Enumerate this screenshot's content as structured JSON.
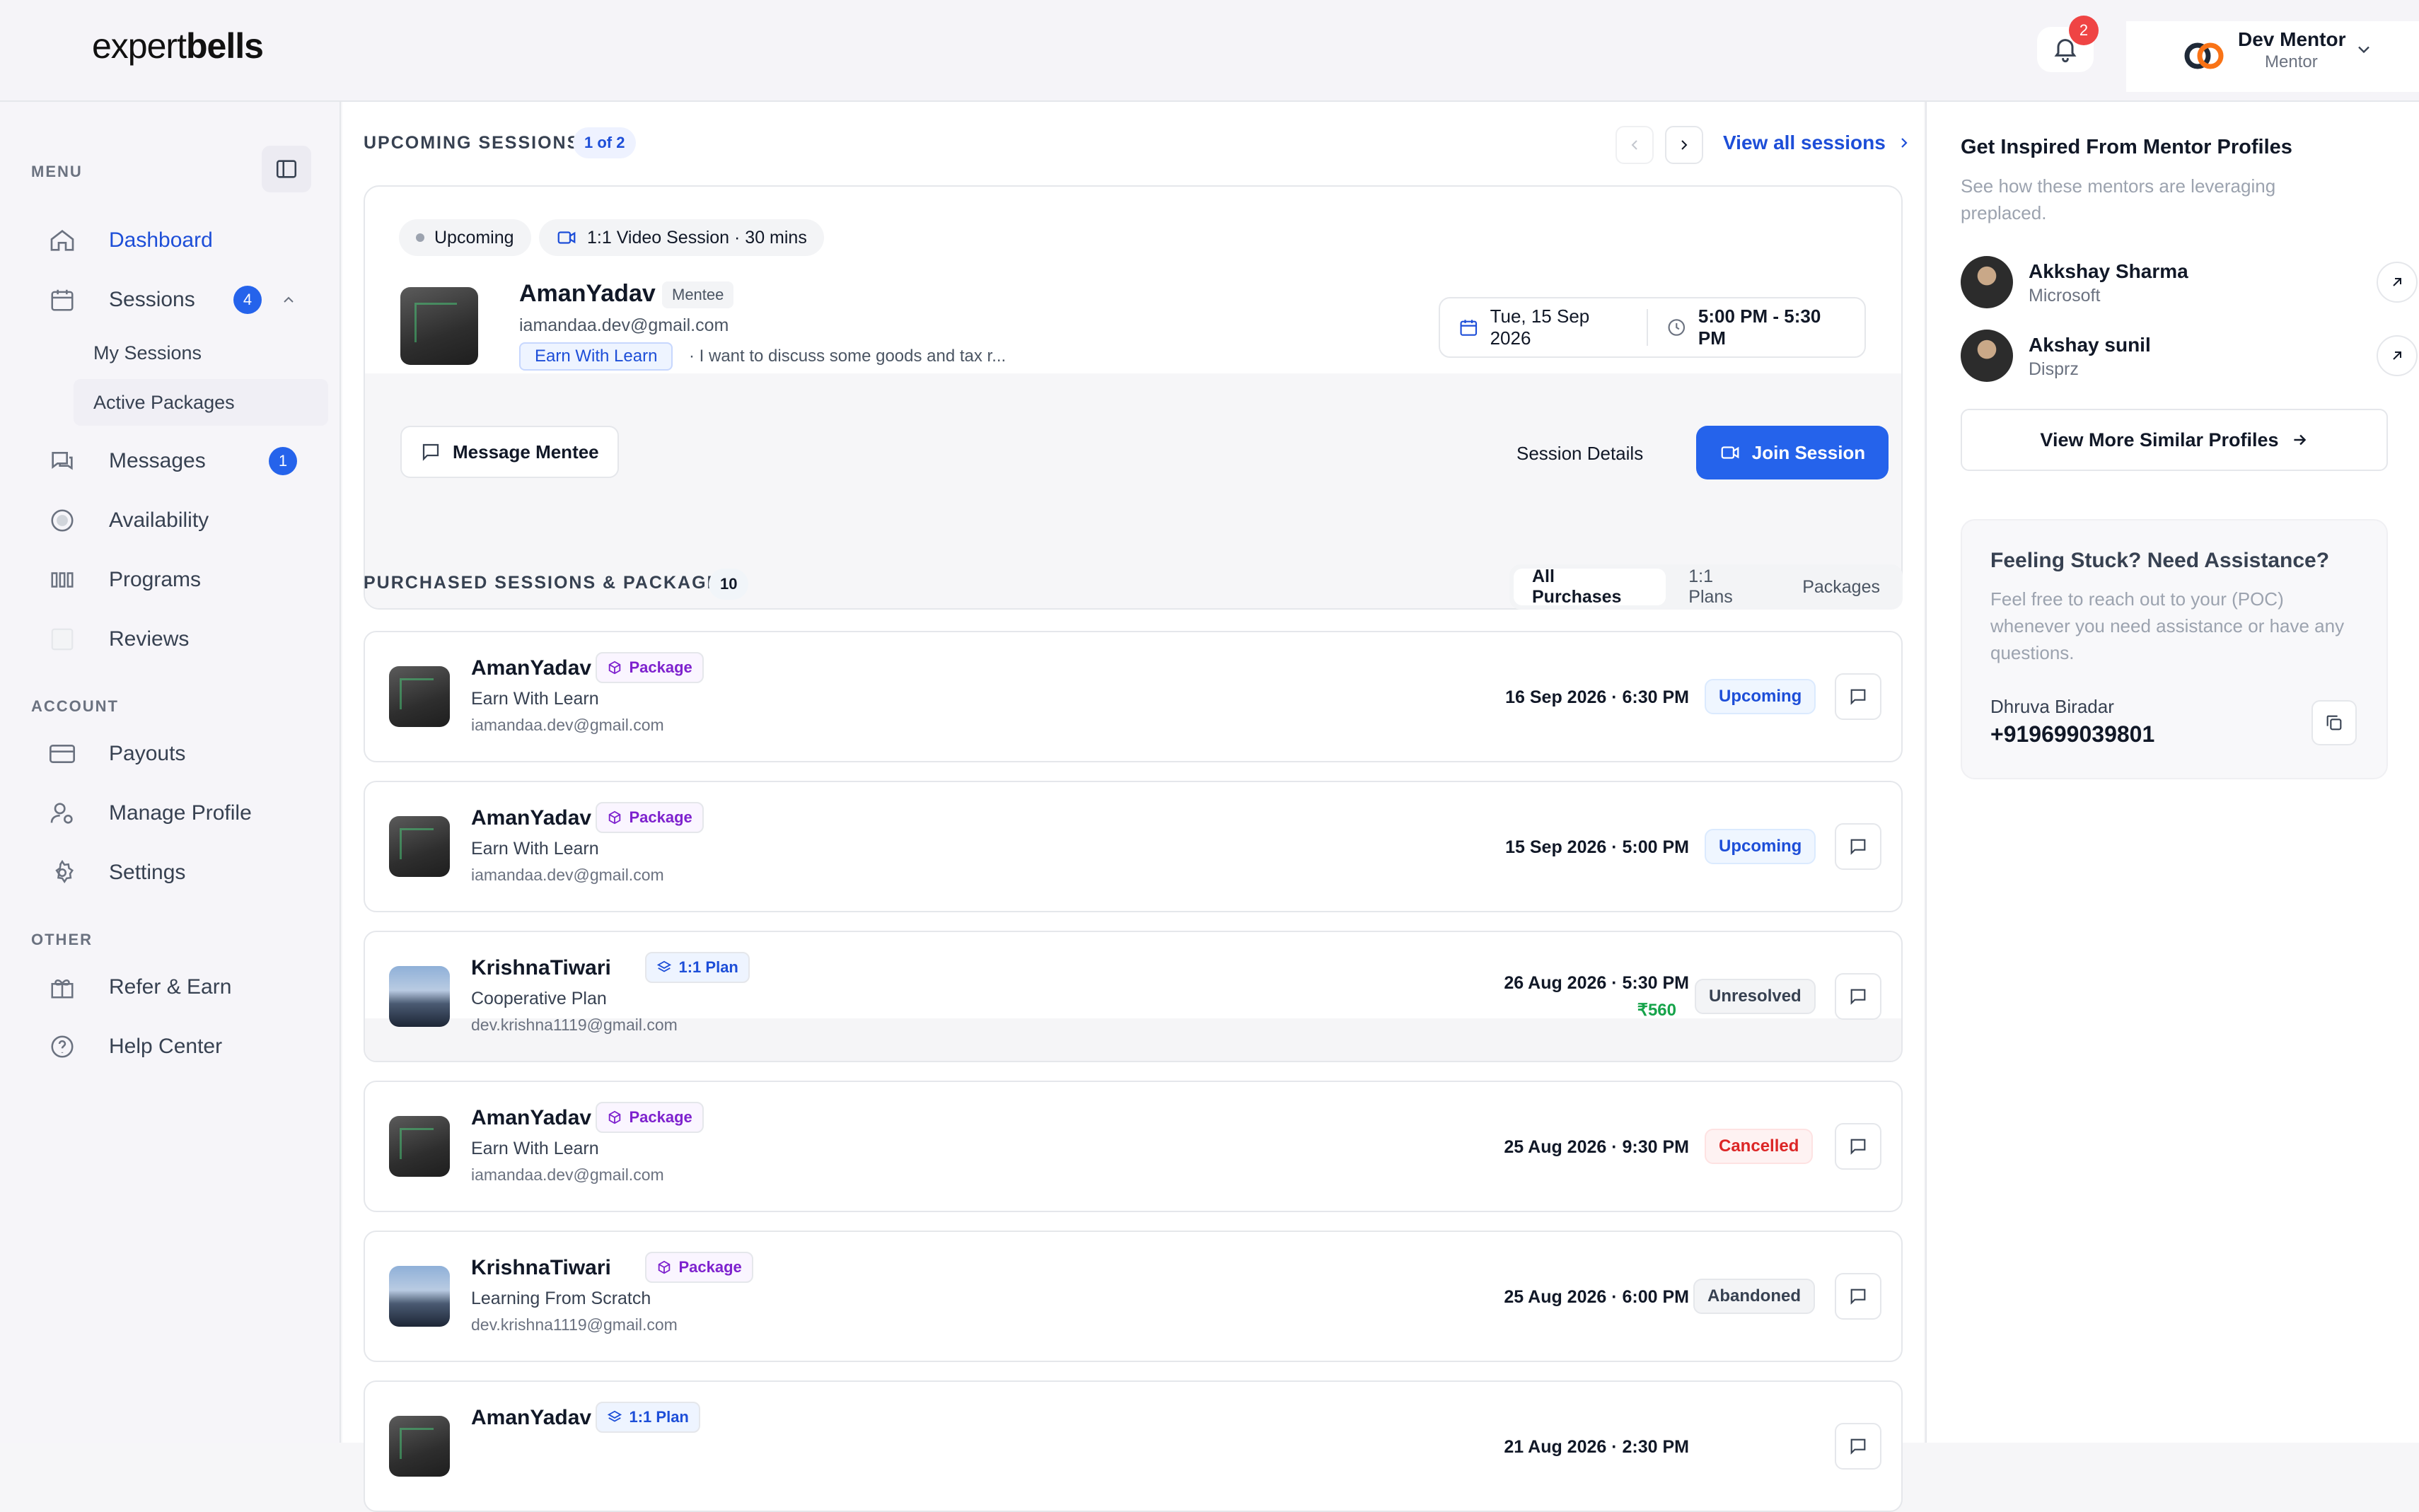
{
  "header": {
    "logo_light": "expert",
    "logo_bold": "bells",
    "notification_count": "2",
    "user_name": "Dev Mentor",
    "user_role": "Mentor"
  },
  "sidebar": {
    "menu_label": "MENU",
    "account_label": "ACCOUNT",
    "other_label": "OTHER",
    "items": {
      "dashboard": "Dashboard",
      "sessions": "Sessions",
      "sessions_badge": "4",
      "my_sessions": "My Sessions",
      "active_packages": "Active Packages",
      "messages": "Messages",
      "messages_badge": "1",
      "availability": "Availability",
      "programs": "Programs",
      "reviews": "Reviews",
      "payouts": "Payouts",
      "manage_profile": "Manage Profile",
      "settings": "Settings",
      "refer_earn": "Refer & Earn",
      "help_center": "Help Center"
    }
  },
  "upcoming": {
    "title": "UPCOMING SESSIONS",
    "pager": "1 of 2",
    "view_all": "View all sessions",
    "card": {
      "status_chip": "Upcoming",
      "type_chip": "1:1 Video Session · 30 mins",
      "name": "AmanYadav",
      "role_tag": "Mentee",
      "email": "iamandaa.dev@gmail.com",
      "topic": "Earn With Learn",
      "note": "· I want to discuss some goods and tax r...",
      "date": "Tue, 15 Sep 2026",
      "time": "5:00 PM - 5:30 PM",
      "message_btn": "Message Mentee",
      "details_btn": "Session Details",
      "join_btn": "Join Session"
    }
  },
  "purchased": {
    "title": "PURCHASED SESSIONS & PACKAGES",
    "count": "10",
    "filters": [
      "All Purchases",
      "1:1 Plans",
      "Packages"
    ],
    "rows": [
      {
        "name": "AmanYadav",
        "type": "Package",
        "kind": "pkg",
        "sub": "Earn With Learn",
        "email": "iamandaa.dev@gmail.com",
        "date": "16 Sep 2026 · 6:30 PM",
        "price": "",
        "status": "Upcoming",
        "status_kind": "up",
        "avatar": "dark"
      },
      {
        "name": "AmanYadav",
        "type": "Package",
        "kind": "pkg",
        "sub": "Earn With Learn",
        "email": "iamandaa.dev@gmail.com",
        "date": "15 Sep 2026 · 5:00 PM",
        "price": "",
        "status": "Upcoming",
        "status_kind": "up",
        "avatar": "dark"
      },
      {
        "name": "KrishnaTiwari",
        "type": "1:1 Plan",
        "kind": "plan",
        "sub": "Cooperative Plan",
        "email": "dev.krishna1119@gmail.com",
        "date": "26 Aug 2026 · 5:30 PM",
        "price": "₹560",
        "status": "Unresolved",
        "status_kind": "unres",
        "avatar": "mount"
      },
      {
        "name": "AmanYadav",
        "type": "Package",
        "kind": "pkg",
        "sub": "Earn With Learn",
        "email": "iamandaa.dev@gmail.com",
        "date": "25 Aug 2026 · 9:30 PM",
        "price": "",
        "status": "Cancelled",
        "status_kind": "canc",
        "avatar": "dark"
      },
      {
        "name": "KrishnaTiwari",
        "type": "Package",
        "kind": "pkg",
        "sub": "Learning From Scratch",
        "email": "dev.krishna1119@gmail.com",
        "date": "25 Aug 2026 · 6:00 PM",
        "price": "",
        "status": "Abandoned",
        "status_kind": "aband",
        "avatar": "mount"
      },
      {
        "name": "AmanYadav",
        "type": "1:1 Plan",
        "kind": "plan",
        "sub": "",
        "email": "",
        "date": "21 Aug 2026 · 2:30 PM",
        "price": "",
        "status": "",
        "status_kind": "unres",
        "avatar": "dark"
      }
    ]
  },
  "right": {
    "title": "Get Inspired From Mentor Profiles",
    "desc": "See how these mentors are leveraging preplaced.",
    "mentors": [
      {
        "name": "Akkshay Sharma",
        "company": "Microsoft"
      },
      {
        "name": "Akshay sunil",
        "company": "Disprz"
      }
    ],
    "view_more": "View More Similar Profiles",
    "assist_title": "Feeling Stuck? Need Assistance?",
    "assist_desc": "Feel free to reach out to your (POC) whenever you need assistance or have any questions.",
    "poc_name": "Dhruva Biradar",
    "poc_phone": "+919699039801"
  },
  "colors": {
    "accent": "#2563eb",
    "danger": "#dc2626",
    "success": "#16a34a"
  }
}
